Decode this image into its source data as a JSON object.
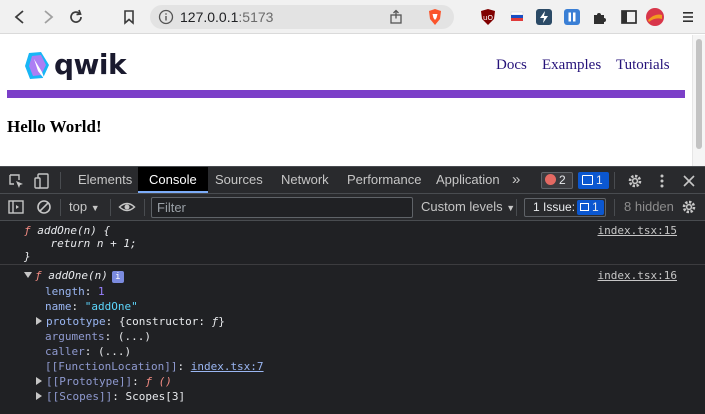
{
  "browser": {
    "url_host": "127.0.0.1",
    "url_port": ":5173"
  },
  "page": {
    "logo_text": "qwik",
    "nav": [
      "Docs",
      "Examples",
      "Tutorials"
    ],
    "heading": "Hello World!"
  },
  "devtools": {
    "tabs": [
      "Elements",
      "Console",
      "Sources",
      "Network",
      "Performance",
      "Application"
    ],
    "active_tab": "Console",
    "more_tabs": "»",
    "error_count": "2",
    "message_count": "1",
    "toolbar": {
      "context": "top",
      "filter_placeholder": "Filter",
      "levels": "Custom levels",
      "issues_label": "1 Issue:",
      "issues_count": "1",
      "hidden": "8 hidden"
    },
    "console": {
      "msg1": {
        "source": "index.tsx:15",
        "l1_kw": "ƒ",
        "l1_rest": " addOne(n) {",
        "l2": "    return n + 1;",
        "l3": "}"
      },
      "msg2": {
        "source": "index.tsx:16",
        "header_kw": "ƒ",
        "header_rest": " addOne(n)",
        "info_badge": "i",
        "length_key": "length",
        "length_val": "1",
        "name_key": "name",
        "name_val": "\"addOne\"",
        "prototype_key": "prototype",
        "prototype_val_open": "{constructor: ",
        "prototype_val_f": "ƒ",
        "prototype_val_close": "}",
        "arguments_key": "arguments",
        "arguments_val": "(...)",
        "caller_key": "caller",
        "caller_val": "(...)",
        "fnloc_key": "[[FunctionLocation]]",
        "fnloc_val": "index.tsx:7",
        "proto_key": "[[Prototype]]",
        "proto_val": "ƒ ()",
        "scopes_key": "[[Scopes]]",
        "scopes_val": "Scopes[3]"
      }
    }
  }
}
